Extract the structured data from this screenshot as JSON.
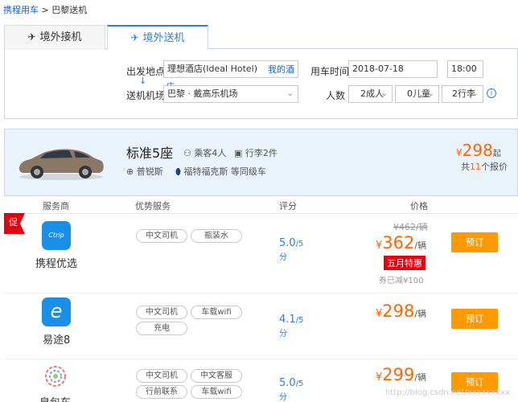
{
  "breadcrumb": {
    "home": "携程用车",
    "sep": ">",
    "current": "巴黎送机"
  },
  "tabs": [
    {
      "label": "境外接机",
      "icon": "plane-landing-icon"
    },
    {
      "label": "境外送机",
      "icon": "plane-takeoff-icon"
    }
  ],
  "form": {
    "depart_label": "出发地点",
    "depart_value": "理想酒店(Ideal Hotel)",
    "my_hotel_link": "我的酒店",
    "airport_label": "送机机场",
    "airport_value": "巴黎 · 戴高乐机场",
    "time_label": "用车时间",
    "date_value": "2018-07-18",
    "time_value": "18:00",
    "people_label": "人数",
    "adults": "2成人",
    "children": "0儿童",
    "luggage": "2行李"
  },
  "car": {
    "name": "标准5座",
    "passengers": "乘客4人",
    "luggage": "行李2件",
    "model_a": "普锐斯",
    "model_b": "福特福克斯 等同级车",
    "from_price": "298",
    "currency": "¥",
    "from_suffix": "起",
    "quote_prefix": "共",
    "quote_count": "11",
    "quote_suffix": "个报价"
  },
  "table_headers": {
    "provider": "服务商",
    "services": "优势服务",
    "score": "评分",
    "price": "价格"
  },
  "rows": [
    {
      "promo": "促",
      "provider": "携程优选",
      "logo_text": "Ctrip",
      "tags": [
        "中文司机",
        "瓶装水"
      ],
      "score": "5.0",
      "score_max": "/5",
      "score_unit": "分",
      "old_price": "¥462/辆",
      "price": "362",
      "price_unit": "/辆",
      "badge": "五月特惠",
      "coupon": "券已减¥100",
      "book": "预订"
    },
    {
      "provider": "易途8",
      "logo_text": "e",
      "tags": [
        "中文司机",
        "车载wifi",
        "充电"
      ],
      "score": "4.1",
      "score_max": "/5",
      "score_unit": "分",
      "price": "298",
      "price_unit": "/辆",
      "book": "预订"
    },
    {
      "provider": "皇包车",
      "tags": [
        "中文司机",
        "中文客服",
        "行前联系",
        "车载wifi"
      ],
      "score": "5.0",
      "score_max": "/5",
      "score_unit": "分",
      "price": "299",
      "price_unit": "/辆",
      "book": "预订"
    }
  ],
  "watermark": "http://blog.csdn.net/xxxxxxxxx",
  "colors": {
    "accent": "#2d7fd6",
    "orange": "#ff6600",
    "button": "#ff9900",
    "promo": "#e60012"
  }
}
